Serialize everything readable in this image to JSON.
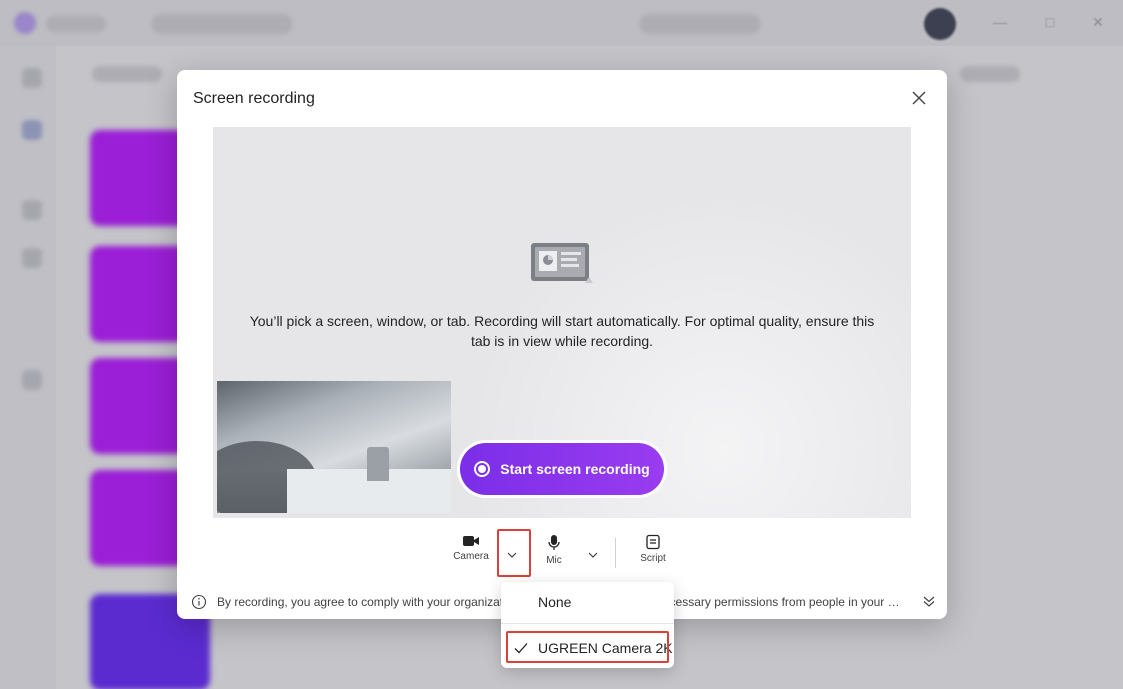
{
  "dialog": {
    "title": "Screen recording",
    "message": "You’ll pick a screen, window, or tab. Recording will start automatically. For optimal quality, ensure this tab is in view while recording.",
    "start_button_label": "Start screen recording"
  },
  "toolbar": {
    "camera_label": "Camera",
    "mic_label": "Mic",
    "script_label": "Script"
  },
  "footer": {
    "text": "By recording, you agree to comply with your organization's policies and obtain any necessary permissions from people in your …"
  },
  "camera_dropdown": {
    "options": [
      {
        "label": "None",
        "selected": false
      },
      {
        "label": "UGREEN Camera 2K",
        "selected": true
      }
    ]
  },
  "colors": {
    "accent": "#8a2be2",
    "annotation_red": "#d9423a"
  },
  "icons": [
    "close-icon",
    "screen-share-illustration-icon",
    "record-icon",
    "video-camera-icon",
    "chevron-down-icon",
    "microphone-icon",
    "script-icon",
    "info-icon",
    "double-chevron-down-icon",
    "checkmark-icon"
  ]
}
